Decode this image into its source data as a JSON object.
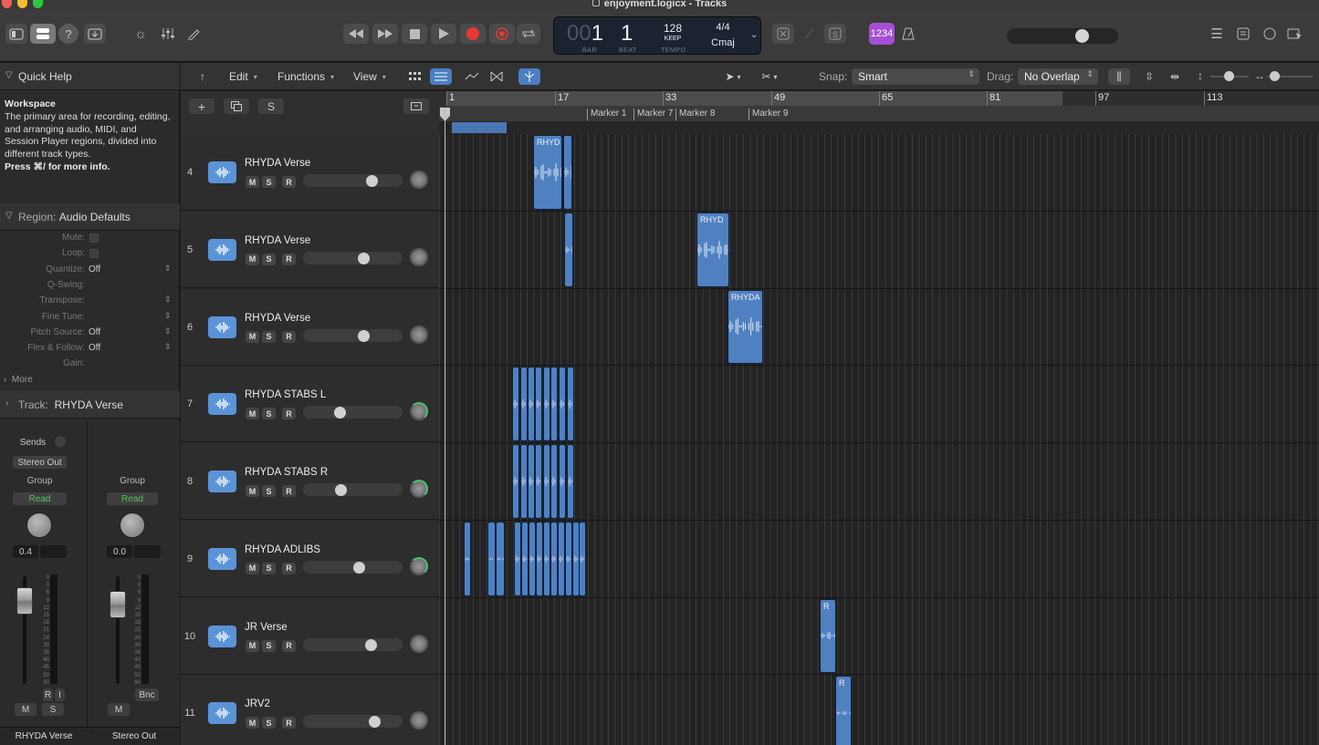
{
  "window": {
    "title": "enjoyment.logicx - Tracks"
  },
  "colors": {
    "accent": "#5a93d6",
    "region": "#4f81c1",
    "record": "#e53935",
    "count_in": "#a64fd3",
    "read": "#58c35a"
  },
  "transport": {
    "rewind_icon": "rewind-icon",
    "forward_icon": "fast-forward-icon",
    "stop_icon": "stop-icon",
    "play_icon": "play-icon",
    "record_icon": "record-icon",
    "cycle_icon": "cycle-icon"
  },
  "lcd": {
    "bar_dim": "00",
    "bar": "1",
    "beat": "1",
    "bar_label": "BAR",
    "beat_label": "BEAT",
    "tempo": "128",
    "tempo_mode": "KEEP",
    "tempo_label": "TEMPO",
    "time_sig": "4/4",
    "key": "Cmaj"
  },
  "count_in_label": "1234",
  "local_menu": {
    "edit": "Edit",
    "functions": "Functions",
    "view": "View"
  },
  "snap": {
    "label": "Snap:",
    "value": "Smart"
  },
  "drag": {
    "label": "Drag:",
    "value": "No Overlap"
  },
  "inspector": {
    "quick_help_title": "Quick Help",
    "qh_heading": "Workspace",
    "qh_text": "The primary area for recording, editing, and arranging audio, MIDI, and Session Player regions, divided into different track types.",
    "qh_shortcut": "Press ⌘/ for more info.",
    "region_prefix": "Region:",
    "region_name": "Audio Defaults",
    "params": [
      {
        "label": "Mute:",
        "value": "",
        "kind": "check"
      },
      {
        "label": "Loop:",
        "value": "",
        "kind": "check"
      },
      {
        "label": "Quantize:",
        "value": "Off",
        "kind": "select"
      },
      {
        "label": "Q-Swing:",
        "value": "",
        "kind": "none"
      },
      {
        "label": "Transpose:",
        "value": "",
        "kind": "select"
      },
      {
        "label": "Fine Tune:",
        "value": "",
        "kind": "select"
      },
      {
        "label": "Pitch Source:",
        "value": "Off",
        "kind": "select"
      },
      {
        "label": "Flex & Follow:",
        "value": "Off",
        "kind": "select"
      },
      {
        "label": "Gain:",
        "value": "",
        "kind": "none"
      }
    ],
    "more_label": "More",
    "track_prefix": "Track:",
    "track_name": "RHYDA Verse"
  },
  "strips": [
    {
      "name": "RHYDA Verse",
      "sends": "Sends",
      "output": "Stereo Out",
      "group": "Group",
      "automation": "Read",
      "pan_value": "0.4",
      "mute": "M",
      "solo": "S",
      "r": "R",
      "i": "I"
    },
    {
      "name": "Stereo Out",
      "group": "Group",
      "automation": "Read",
      "pan_value": "0.0",
      "mute": "M",
      "bounce": "Bnc"
    }
  ],
  "meter_scale": [
    "0",
    "3",
    "6",
    "9",
    "12",
    "15",
    "18",
    "21",
    "24",
    "30",
    "35",
    "40",
    "45",
    "50",
    "60"
  ],
  "ruler": {
    "bars": [
      "1",
      "17",
      "33",
      "49",
      "65",
      "81",
      "97",
      "113"
    ],
    "markers": [
      "Marker 1",
      "Marker 7",
      "Marker 8",
      "Marker 9"
    ]
  },
  "tracks": [
    {
      "number": "4",
      "name": "RHYDA Verse",
      "volume": 0.72,
      "pan_tint": "gray"
    },
    {
      "number": "5",
      "name": "RHYDA Verse",
      "volume": 0.62,
      "pan_tint": "gray"
    },
    {
      "number": "6",
      "name": "RHYDA Verse",
      "volume": 0.62,
      "pan_tint": "gray"
    },
    {
      "number": "7",
      "name": "RHYDA STABS L",
      "volume": 0.35,
      "pan_tint": "green"
    },
    {
      "number": "8",
      "name": "RHYDA  STABS R",
      "volume": 0.36,
      "pan_tint": "green"
    },
    {
      "number": "9",
      "name": "RHYDA ADLIBS",
      "volume": 0.57,
      "pan_tint": "green"
    },
    {
      "number": "10",
      "name": "JR Verse",
      "volume": 0.71,
      "pan_tint": "gray"
    },
    {
      "number": "11",
      "name": "JRV2",
      "volume": 0.75,
      "pan_tint": "gray"
    }
  ],
  "track_buttons": {
    "mute": "M",
    "solo": "S",
    "record": "R"
  },
  "regions": {
    "r4": "RHYD",
    "r5": "RHYD",
    "r6": "RHYDA",
    "r10": "R",
    "r11": "R"
  }
}
